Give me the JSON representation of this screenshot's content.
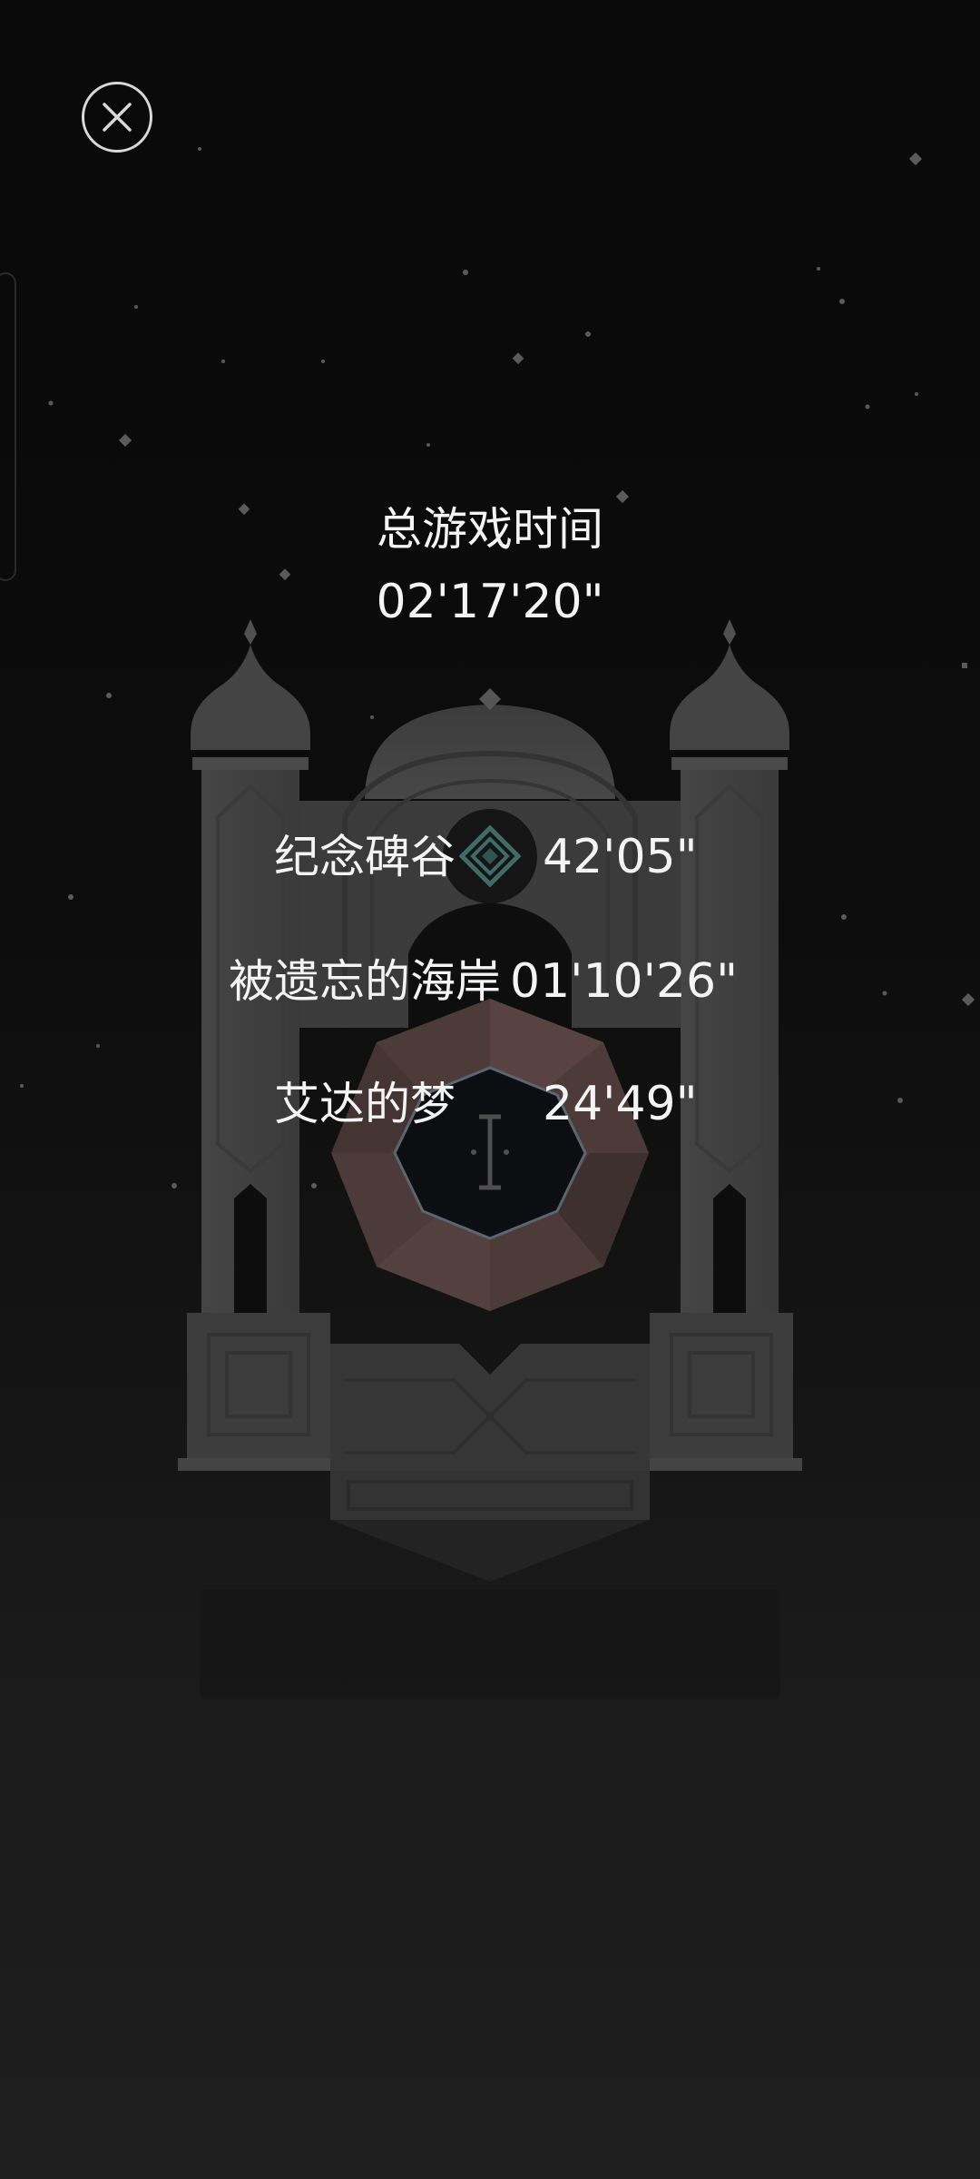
{
  "close_button": {
    "icon": "close-icon"
  },
  "summary": {
    "title": "总游戏时间",
    "total_time": "02'17'20\""
  },
  "chapters": [
    {
      "label": "纪念碑谷",
      "time": "42'05\""
    },
    {
      "label": "被遗忘的海岸",
      "time": "01'10'26\""
    },
    {
      "label": "艾达的梦",
      "time": "24'49\""
    }
  ],
  "emblem": {
    "icon": "diamond-emblem-icon",
    "color": "#3f6b68"
  },
  "center_glyph": {
    "icon": "roman-numeral-one-icon"
  },
  "colors": {
    "background": "#0b0b0b",
    "text": "#f4f4f4",
    "monument": "#4a4a4a",
    "gem": "#4d3b3a"
  }
}
